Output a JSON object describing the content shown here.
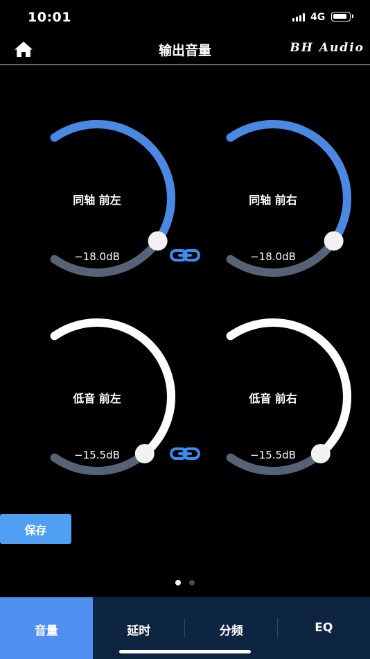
{
  "status_bar": {
    "time": "10:01",
    "network": "4G"
  },
  "nav": {
    "title": "输出音量",
    "brand": "BH Audio"
  },
  "channels": [
    {
      "label": "同轴 前左",
      "value": "−18.0dB",
      "level": 0.64,
      "color": "#4a88e4"
    },
    {
      "label": "同轴 前右",
      "value": "−18.0dB",
      "level": 0.64,
      "color": "#4a88e4"
    },
    {
      "label": "低音 前左",
      "value": "−15.5dB",
      "level": 0.7,
      "color": "#ffffff"
    },
    {
      "label": "低音 前右",
      "value": "−15.5dB",
      "level": 0.7,
      "color": "#ffffff"
    }
  ],
  "track_color": "#566377",
  "link_color": "#3b8cf0",
  "save_button": {
    "label": "保存"
  },
  "pager": {
    "count": 2,
    "active": 0
  },
  "tabs": [
    {
      "label": "音量",
      "active": true
    },
    {
      "label": "延时",
      "active": false
    },
    {
      "label": "分频",
      "active": false
    },
    {
      "label": "EQ",
      "active": false
    }
  ]
}
